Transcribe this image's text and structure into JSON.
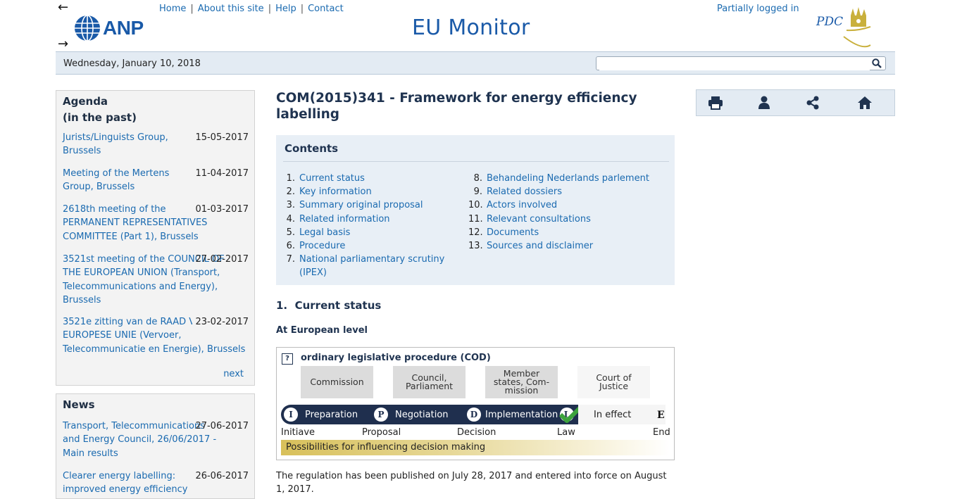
{
  "header": {
    "back_arrow": "←",
    "forward_arrow": "→",
    "logo_text": "ANP",
    "nav": [
      "Home",
      "About this site",
      "Help",
      "Contact"
    ],
    "brand": "EU Monitor",
    "login_status": "Partially logged in",
    "partner_logo_text": "PDC"
  },
  "datebar": {
    "date": "Wednesday, January 10, 2018",
    "search_value": ""
  },
  "agenda": {
    "title_line1": "Agenda",
    "title_line2": "(in the past)",
    "items": [
      {
        "title": "Jurists/Linguists Group, Brussels",
        "date": "15-05-2017"
      },
      {
        "title": "Meeting of the Mertens Group, Brussels",
        "date": "11-04-2017"
      },
      {
        "title": "2618th meeting of the PERMANENT REPRESENTATIVES COMMITTEE (Part 1), Brussels",
        "date": "01-03-2017"
      },
      {
        "title": "3521st meeting of the COUNCIL OF THE EUROPEAN UNION (Transport, Telecommunications and Energy), Brussels",
        "date": "27-02-2017"
      },
      {
        "title": "3521e zitting van de RAAD VAN DE EUROPESE UNIE (Vervoer, Telecommunicatie en Energie), Brussels",
        "date": "23-02-2017"
      }
    ],
    "next": "next"
  },
  "news": {
    "title": "News",
    "items": [
      {
        "title": "Transport, Telecommunications and Energy Council, 26/06/2017 - Main results",
        "date": "27-06-2017"
      },
      {
        "title": "Clearer energy labelling: improved energy efficiency",
        "date": "26-06-2017"
      }
    ]
  },
  "main": {
    "title": "COM(2015)341 - Framework for energy efficiency labelling",
    "contents_title": "Contents",
    "toc_left": [
      {
        "n": "1.",
        "label": "Current status"
      },
      {
        "n": "2.",
        "label": "Key information"
      },
      {
        "n": "3.",
        "label": "Summary original proposal"
      },
      {
        "n": "4.",
        "label": "Related information"
      },
      {
        "n": "5.",
        "label": "Legal basis"
      },
      {
        "n": "6.",
        "label": "Procedure"
      },
      {
        "n": "7.",
        "label": "National parliamentary scrutiny (IPEX)"
      }
    ],
    "toc_right": [
      {
        "n": "8.",
        "label": "Behandeling Nederlands parlement"
      },
      {
        "n": "9.",
        "label": "Related dossiers"
      },
      {
        "n": "10.",
        "label": "Actors involved"
      },
      {
        "n": "11.",
        "label": "Relevant consultations"
      },
      {
        "n": "12.",
        "label": "Documents"
      },
      {
        "n": "13.",
        "label": "Sources and disclaimer"
      }
    ],
    "section_heading_num": "1.",
    "section_heading": "Current status",
    "level": "At European level",
    "procedure": {
      "help": "?",
      "title": "ordinary legislative procedure (COD)",
      "actors": [
        "Commission",
        "Council, Parliament",
        "Member states, Com-mission",
        "Court of Justice"
      ],
      "stages": [
        {
          "badge": "I",
          "label": "Preparation"
        },
        {
          "badge": "P",
          "label": "Negotiation"
        },
        {
          "badge": "D",
          "label": "Implementation"
        },
        {
          "badge": "L",
          "label": ""
        }
      ],
      "in_effect": "In effect",
      "end_badge": "E",
      "milestones": [
        "Initiave",
        "Proposal",
        "Decision",
        "Law",
        "End"
      ],
      "influence": "Possibilities for influencing decision making"
    },
    "body_text": "The regulation has been published on July 28, 2017 and entered into force on August 1, 2017."
  },
  "colors": {
    "link": "#1a6ab0",
    "heading": "#1f3350",
    "stagebar": "#1f2f4e",
    "check": "#3da33d"
  }
}
